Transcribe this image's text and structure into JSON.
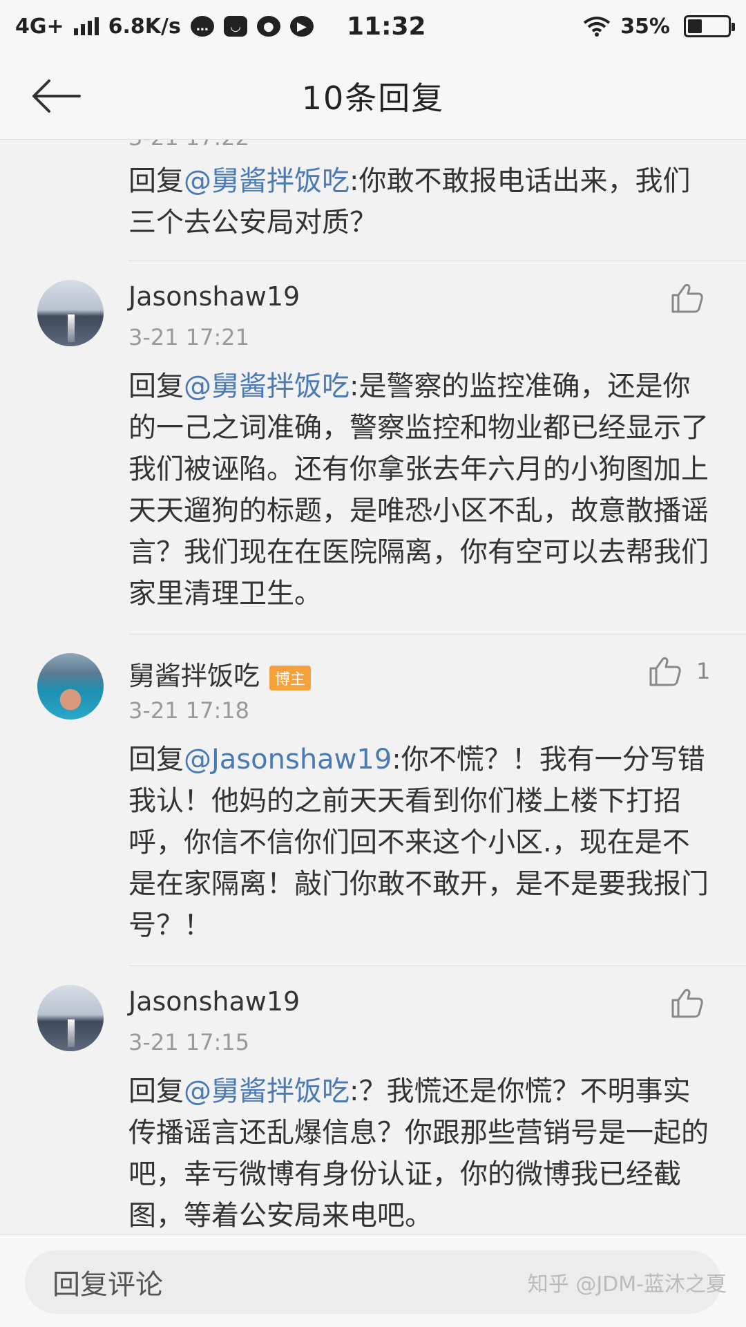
{
  "status_bar": {
    "network": "4G+",
    "speed": "6.8K/s",
    "time": "11:32",
    "battery": "35%",
    "battery_level": 0.35
  },
  "header": {
    "title": "10条回复"
  },
  "partial_timestamp": "3-21 17:22",
  "comments": [
    {
      "mention": "@舅酱拌饭吃",
      "text": ":你敢不敢报电话出来，我们三个去公安局对质？"
    },
    {
      "username": "Jasonshaw19",
      "time": "3-21 17:21",
      "prefix": "回复",
      "mention": "@舅酱拌饭吃",
      "text": ":是警察的监控准确，还是你的一己之词准确，警察监控和物业都已经显示了我们被诬陷。还有你拿张去年六月的小狗图加上天天遛狗的标题，是唯恐小区不乱，故意散播谣言？我们现在在医院隔离，你有空可以去帮我们家里清理卫生。",
      "likes": ""
    },
    {
      "username": "舅酱拌饭吃",
      "badge": "博主",
      "time": "3-21 17:18",
      "prefix": "回复",
      "mention": "@Jasonshaw19",
      "text": ":你不慌？！我有一分写错我认！他妈的之前天天看到你们楼上楼下打招呼，你信不信你们回不来这个小区.，现在是不是在家隔离！敲门你敢不敢开，是不是要我报门号？！",
      "likes": "1"
    },
    {
      "username": "Jasonshaw19",
      "time": "3-21 17:15",
      "prefix": "回复",
      "mention": "@舅酱拌饭吃",
      "text": ":？我慌还是你慌？不明事实传播谣言还乱爆信息？你跟那些营销号是一起的吧，幸亏微博有身份认证，你的微博我已经截图，等着公安局来电吧。",
      "likes": ""
    }
  ],
  "first_prefix": "回复",
  "bottom": {
    "placeholder": "回复评论",
    "watermark": "知乎 @JDM-蓝沐之夏"
  }
}
